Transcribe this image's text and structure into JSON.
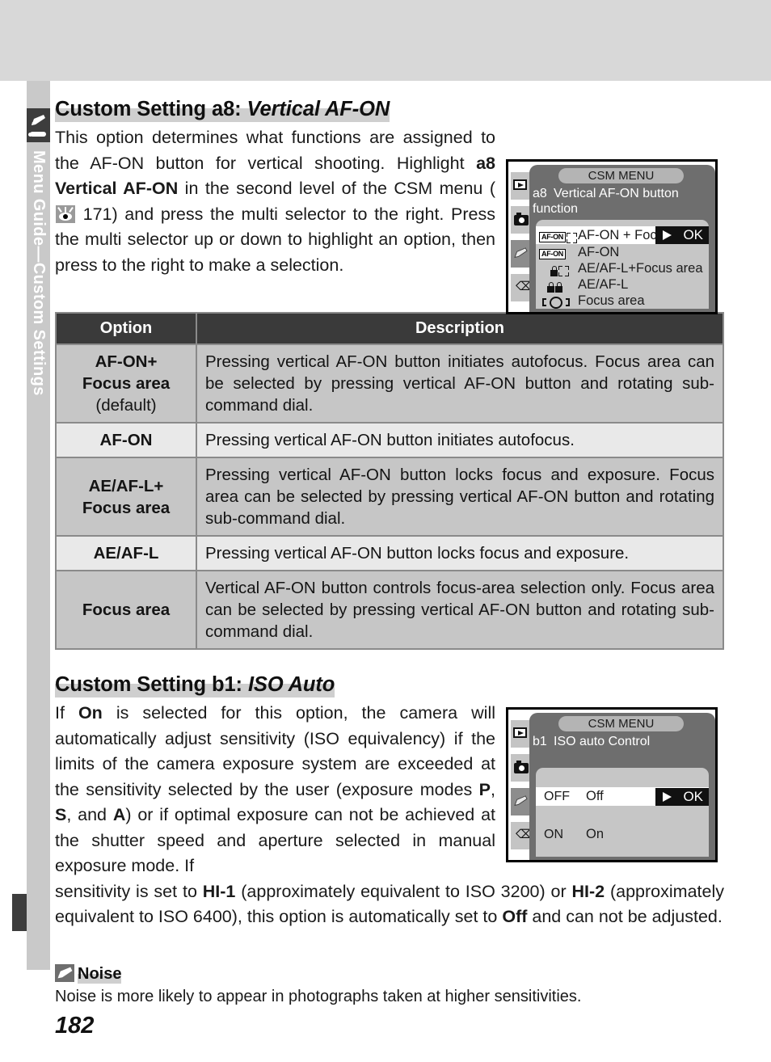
{
  "sidebar": {
    "vertical_label": "Menu Guide—Custom Settings",
    "icon": "pencil-icon"
  },
  "section_a8": {
    "heading_plain": "Custom Setting a8: ",
    "heading_italic": "Vertical AF-ON",
    "body_1": "This option determines what functions are assigned to the AF-ON button for vertical shooting. Highlight ",
    "body_bold_1": "a8 Vertical AF-ON",
    "body_2": " in the second level of the CSM menu (",
    "body_ref": "171",
    "body_3": ") and press the multi selector to the right.  Press the multi selector up or down to highlight an option, then press to the right to make a selection."
  },
  "lcd_a8": {
    "title": "CSM MENU",
    "code": "a8",
    "heading": "Vertical AF-ON button function",
    "ok_label": "OK",
    "items": [
      {
        "label": "AF-ON + Focus area",
        "icon": "afon-focusarea-icon",
        "selected": true
      },
      {
        "label": "AF-ON",
        "icon": "afon-icon",
        "selected": false
      },
      {
        "label": "AE/AF-L+Focus area",
        "icon": "aeafl-focusarea-icon",
        "selected": false
      },
      {
        "label": "AE/AF-L",
        "icon": "aeafl-icon",
        "selected": false
      },
      {
        "label": "Focus area",
        "icon": "focusarea-icon",
        "selected": false
      }
    ],
    "side_icons": [
      "playback-icon",
      "camera-icon",
      "pencil-icon",
      "wrench-icon"
    ]
  },
  "table": {
    "headers": [
      "Option",
      "Description"
    ],
    "rows": [
      {
        "option": "AF-ON+\nFocus area",
        "option_sub": "(default)",
        "description": "Pressing vertical AF-ON button initiates autofocus.  Focus area can be selected by pressing vertical AF-ON button and rotating sub-command dial.",
        "shade": "dark"
      },
      {
        "option": "AF-ON",
        "option_sub": "",
        "description": "Pressing vertical AF-ON button initiates autofocus.",
        "shade": "light"
      },
      {
        "option": "AE/AF-L+\nFocus area",
        "option_sub": "",
        "description": "Pressing vertical AF-ON button locks focus and exposure.  Focus area can be selected by pressing vertical AF-ON button and rotating sub-command dial.",
        "shade": "dark"
      },
      {
        "option": "AE/AF-L",
        "option_sub": "",
        "description": "Pressing vertical AF-ON button locks focus and exposure.",
        "shade": "light"
      },
      {
        "option": "Focus area",
        "option_sub": "",
        "description": "Vertical AF-ON button controls focus-area selection only.  Focus area can be selected by pressing vertical AF-ON button and rotating sub-command dial.",
        "shade": "dark"
      }
    ]
  },
  "section_b1": {
    "heading_plain": "Custom Setting b1: ",
    "heading_italic": "ISO Auto",
    "col_1": "If ",
    "col_bold_on": "On",
    "col_2": " is selected for this option, the camera will automatically adjust sensitivity (ISO equivalency) if the limits of the camera exposure system are exceeded at the sensitivity selected by the user (exposure modes ",
    "col_bold_p": "P",
    "col_comma1": ", ",
    "col_bold_s": "S",
    "col_and": ", and ",
    "col_bold_a": "A",
    "col_3": ") or if optimal exposure can not be achieved at the shutter speed and aperture selected in manual exposure mode.  If ",
    "full_1": "sensitivity is set to ",
    "full_bold_hi1": "HI-1",
    "full_2": " (approximately equivalent to ISO 3200) or ",
    "full_bold_hi2": "HI-2",
    "full_3": " (approximately equivalent to ISO 6400), this option is automatically set to ",
    "full_bold_off": "Off",
    "full_4": " and can not be adjusted."
  },
  "lcd_b1": {
    "title": "CSM MENU",
    "code": "b1",
    "heading": "ISO auto Control",
    "ok_label": "OK",
    "items": [
      {
        "badge": "OFF",
        "label": "Off",
        "selected": true
      },
      {
        "badge": "ON",
        "label": "On",
        "selected": false
      }
    ],
    "side_icons": [
      "playback-icon",
      "camera-icon",
      "pencil-icon",
      "wrench-icon"
    ]
  },
  "note": {
    "title": "Noise",
    "icon": "pencil-note-icon",
    "body": "Noise is more likely to appear in photographs taken at higher sensitivities."
  },
  "page_number": "182",
  "colors": {
    "top_band": "#d8d8d8",
    "sidebar": "#c9c9c9",
    "tab_dark": "#3d3d3d",
    "table_header": "#3a3a3a",
    "row_dark": "#c6c6c6",
    "row_light": "#e9e9e9",
    "highlight": "#cfcfcf",
    "lcd_body": "#6e6e6e",
    "lcd_panel": "#c6c6c6"
  }
}
